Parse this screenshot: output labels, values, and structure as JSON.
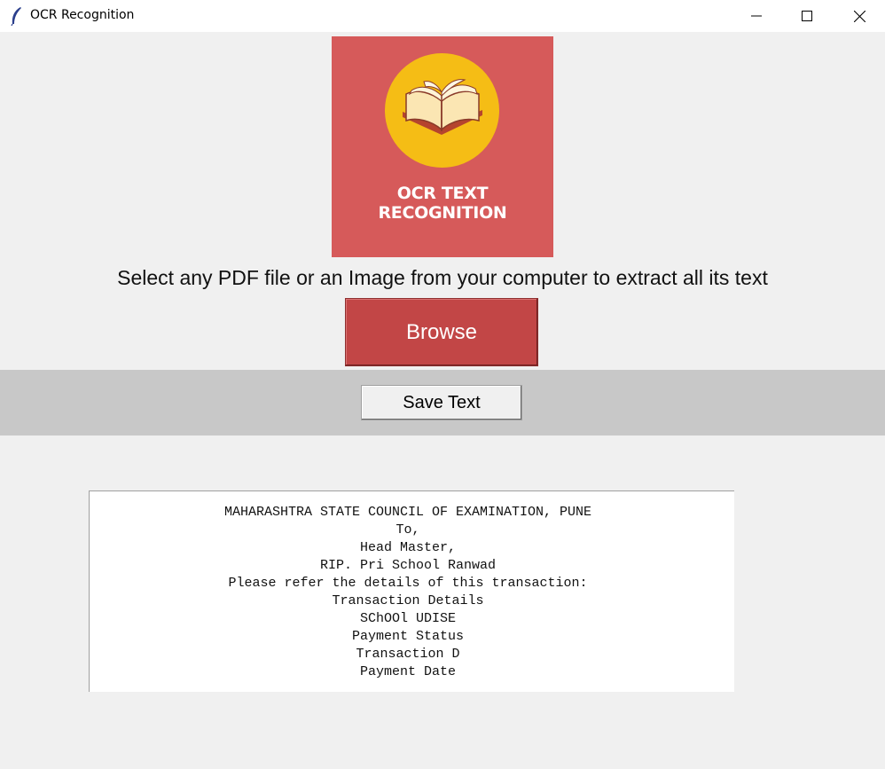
{
  "window": {
    "title": "OCR Recognition",
    "icon": "feather-icon"
  },
  "logo": {
    "line1": "OCR TEXT",
    "line2": "RECOGNITION",
    "background_color": "#d65a5a",
    "circle_color": "#f5bd15",
    "icon": "open-book-icon"
  },
  "main": {
    "instruction": "Select any PDF file or an Image from your computer to extract all its text",
    "browse_label": "Browse",
    "browse_color": "#c24646",
    "save_label": "Save Text"
  },
  "output": {
    "lines": [
      "MAHARASHTRA STATE COUNCIL OF EXAMINATION, PUNE",
      "To,",
      "Head Master,",
      "RIP. Pri School Ranwad",
      "Please refer the details of this transaction:",
      "Transaction Details",
      "SChOOl UDISE",
      "Payment Status",
      "Transaction D",
      "Payment Date"
    ]
  }
}
